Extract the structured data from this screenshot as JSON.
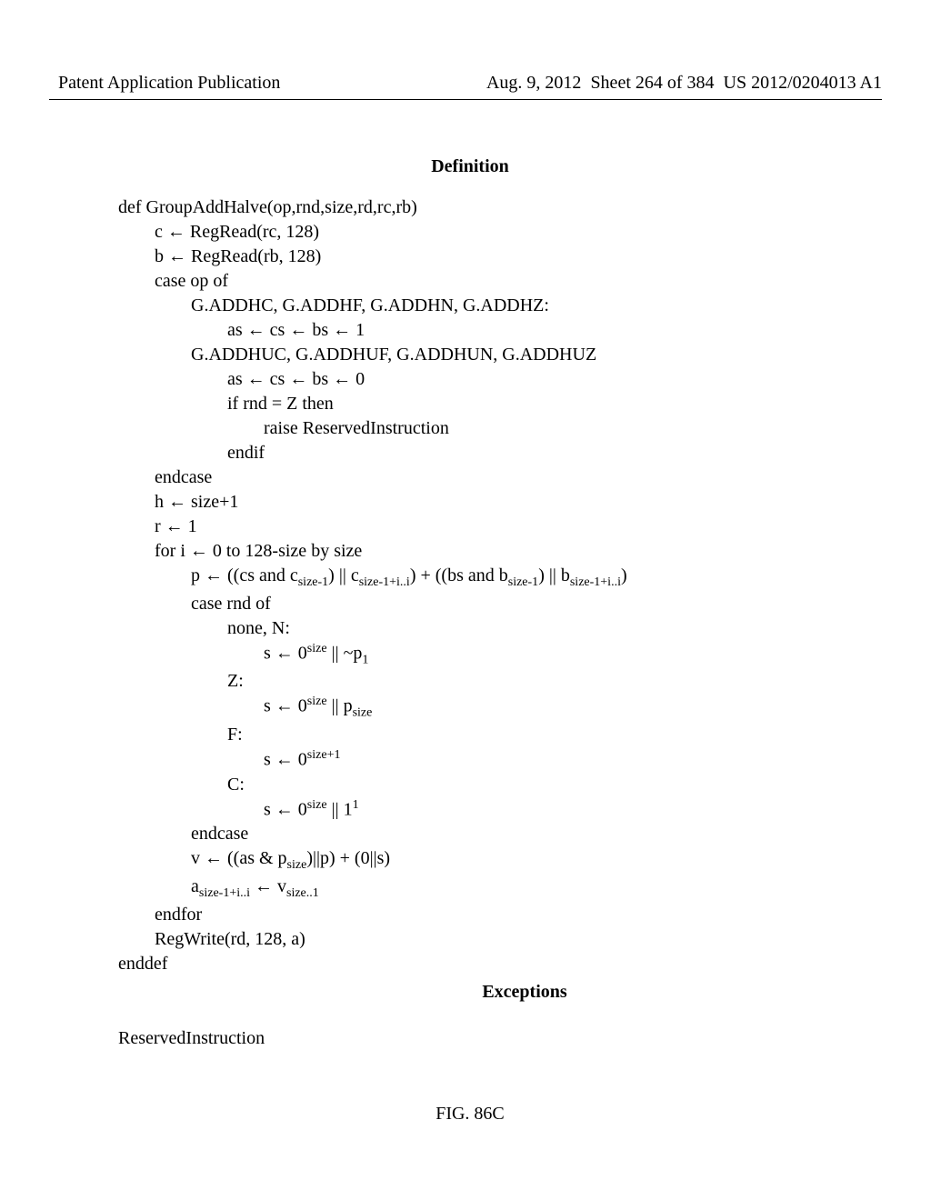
{
  "header": {
    "left": "Patent Application Publication",
    "right_date": "Aug. 9, 2012",
    "right_sheet": "Sheet 264 of 384",
    "right_pubno": "US 2012/0204013 A1"
  },
  "titles": {
    "definition": "Definition",
    "exceptions": "Exceptions"
  },
  "code": {
    "l01": "def GroupAddHalve(op,rnd,size,rd,rc,rb)",
    "l02": "c ← RegRead(rc, 128)",
    "l03": "b ← RegRead(rb, 128)",
    "l04": "case op of",
    "l05": "G.ADDHC, G.ADDHF, G.ADDHN, G.ADDHZ:",
    "l06": "as ← cs ← bs ← 1",
    "l07": "G.ADDHUC, G.ADDHUF, G.ADDHUN, G.ADDHUZ",
    "l08": "as ← cs ← bs ← 0",
    "l09": "if rnd = Z then",
    "l10": "raise ReservedInstruction",
    "l11": "endif",
    "l12": "endcase",
    "l13": "h ← size+1",
    "l14": "r ← 1",
    "l15": "for i ← 0 to 128-size by size",
    "l16_pre": "p ← ((cs and c",
    "l16_s1": "size-1",
    "l16_mid1": ") || c",
    "l16_s2": "size-1+i..i",
    "l16_mid2": ") + ((bs and b",
    "l16_s3": "size-1",
    "l16_mid3": ") || b",
    "l16_s4": "size-1+i..i",
    "l16_end": ")",
    "l17": "case rnd of",
    "l18": "none, N:",
    "l19_pre": "s ← 0",
    "l19_sup": "size",
    "l19_mid": " || ~p",
    "l19_sub": "1",
    "l20": "Z:",
    "l21_pre": "s ← 0",
    "l21_sup": "size",
    "l21_mid": " || p",
    "l21_sub": "size",
    "l22": "F:",
    "l23_pre": "s ← 0",
    "l23_sup": "size+1",
    "l24": "C:",
    "l25_pre": "s ← 0",
    "l25_sup": "size",
    "l25_mid": " || 1",
    "l25_sup2": "1",
    "l26": "endcase",
    "l27_pre": "v ← ((as & p",
    "l27_sub": "size",
    "l27_end": ")||p) + (0||s)",
    "l28_pre": "a",
    "l28_sub1": "size-1+i..i",
    "l28_mid": " ← v",
    "l28_sub2": "size..1",
    "l29": "endfor",
    "l30": "RegWrite(rd, 128, a)",
    "l31": "enddef"
  },
  "exception_text": "ReservedInstruction",
  "figure": "FIG. 86C"
}
